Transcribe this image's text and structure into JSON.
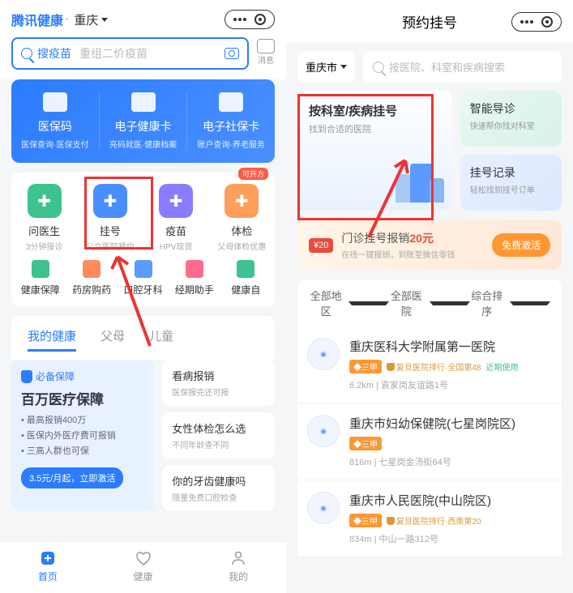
{
  "left": {
    "brand": "腾讯健康",
    "city": "重庆",
    "search_label": "搜疫苗",
    "search_hint": "重组二价疫苗",
    "msg": "消息",
    "cards": [
      {
        "title": "医保码",
        "sub": "医保查询·医保支付"
      },
      {
        "title": "电子健康卡",
        "sub": "亮码就医·健康档案"
      },
      {
        "title": "电子社保卡",
        "sub": "账户查询·养老服务"
      }
    ],
    "badge_kkf": "可开方",
    "grid1": [
      {
        "title": "问医生",
        "sub": "3分钟接诊",
        "color": "#3ec28f"
      },
      {
        "title": "挂号",
        "sub": "公立医院预约",
        "color": "#4a8fff"
      },
      {
        "title": "疫苗",
        "sub": "HPV现货",
        "color": "#8b7cff"
      },
      {
        "title": "体检",
        "sub": "父母体检优惠",
        "color": "#ff9f5b"
      }
    ],
    "grid2": [
      {
        "title": "健康保障",
        "color": "#3ec28f"
      },
      {
        "title": "药房购药",
        "color": "#ff8b5b"
      },
      {
        "title": "口腔牙科",
        "color": "#5b9aff"
      },
      {
        "title": "经期助手",
        "color": "#ff6b8b"
      },
      {
        "title": "健康自",
        "color": "#3ec28f"
      }
    ],
    "tabs": [
      "我的健康",
      "父母",
      "儿童"
    ],
    "health_big": {
      "badge": "必备保障",
      "title": "百万医疗保障",
      "lines": [
        "最高报销400万",
        "医保内外医疗费可报销",
        "三高人群也可保"
      ],
      "cta": "3.5元/月起，立即激活"
    },
    "health_small": [
      {
        "title": "看病报销",
        "sub": "医保报完还可报"
      },
      {
        "title": "女性体检怎么选",
        "sub": "不同年龄查不同"
      },
      {
        "title": "你的牙齿健康吗",
        "sub": "限量免费口腔检查"
      }
    ],
    "nav": [
      "首页",
      "健康",
      "我的"
    ]
  },
  "right": {
    "title": "预约挂号",
    "city": "重庆市",
    "search_placeholder": "按医院、科室和疾病搜索",
    "feat_big": {
      "title": "按科室/疾病挂号",
      "sub": "找到合适的医院"
    },
    "feat_small": [
      {
        "title": "智能导诊",
        "sub": "快速帮你找对科室"
      },
      {
        "title": "挂号记录",
        "sub": "轻松找到挂号订单"
      }
    ],
    "banner": {
      "coupon": "¥20",
      "title_a": "门诊挂号报销",
      "title_b": "20元",
      "sub": "在线一键报销，到账至微信零钱",
      "btn": "免费激活"
    },
    "filters": [
      "全部地区",
      "全部医院",
      "综合排序"
    ],
    "hospitals": [
      {
        "name": "重庆医科大学附属第一医院",
        "level": "三甲",
        "rank": "复旦医院排行·全国第48",
        "recent": "近期使用",
        "addr": "6.2km | 袁家岗友谊路1号"
      },
      {
        "name": "重庆市妇幼保健院(七星岗院区)",
        "level": "三甲",
        "rank": "",
        "recent": "",
        "addr": "816m | 七星岗金汤街64号"
      },
      {
        "name": "重庆市人民医院(中山院区)",
        "level": "三甲",
        "rank": "复旦医院排行·西南第20",
        "recent": "",
        "addr": "834m | 中山一路312号"
      }
    ]
  }
}
